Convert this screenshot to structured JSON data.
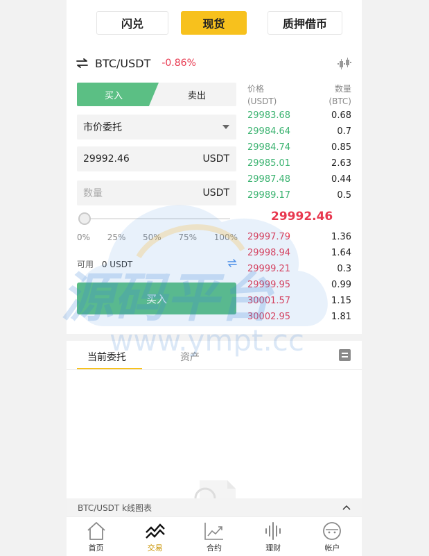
{
  "top_tabs": [
    {
      "label": "闪兑"
    },
    {
      "label": "现货"
    },
    {
      "label": "质押借币"
    }
  ],
  "pair": {
    "name": "BTC/USDT",
    "change": "-0.86%"
  },
  "trade": {
    "buy_label": "买入",
    "sell_label": "卖出",
    "order_type": "市价委托",
    "price_value": "29992.46",
    "price_unit": "USDT",
    "amount_placeholder": "数量",
    "amount_unit": "USDT",
    "slider_percent": 0,
    "percents": [
      "0%",
      "25%",
      "50%",
      "75%",
      "100%"
    ],
    "available_label": "可用",
    "available_value": "0 USDT",
    "submit_label": "买入"
  },
  "orderbook": {
    "price_header": "价格",
    "price_unit": "(USDT)",
    "qty_header": "数量",
    "qty_unit": "(BTC)",
    "bids": [
      {
        "price": "29983.68",
        "qty": "0.68"
      },
      {
        "price": "29984.64",
        "qty": "0.7"
      },
      {
        "price": "29984.74",
        "qty": "0.85"
      },
      {
        "price": "29985.01",
        "qty": "2.63"
      },
      {
        "price": "29987.48",
        "qty": "0.44"
      },
      {
        "price": "29989.17",
        "qty": "0.5"
      }
    ],
    "last_price": "29992.46",
    "asks": [
      {
        "price": "29997.79",
        "qty": "1.36"
      },
      {
        "price": "29998.94",
        "qty": "1.64"
      },
      {
        "price": "29999.21",
        "qty": "0.3"
      },
      {
        "price": "29999.95",
        "qty": "0.99"
      },
      {
        "price": "30001.57",
        "qty": "1.15"
      },
      {
        "price": "30002.95",
        "qty": "1.81"
      }
    ]
  },
  "orders_tabs": {
    "current": "当前委托",
    "assets": "资产"
  },
  "kline_bar": {
    "label": "BTC/USDT k线图表"
  },
  "bottom_nav": [
    {
      "label": "首页",
      "icon": "home-icon"
    },
    {
      "label": "交易",
      "icon": "trade-icon"
    },
    {
      "label": "合约",
      "icon": "contract-icon"
    },
    {
      "label": "理财",
      "icon": "finance-icon"
    },
    {
      "label": "帐户",
      "icon": "account-icon"
    }
  ],
  "watermark": {
    "text": "源码平台",
    "url": "www.ympt.cc"
  },
  "colors": {
    "accent": "#f7c11d",
    "buy": "#5bbf84",
    "sell": "#e8384f"
  }
}
